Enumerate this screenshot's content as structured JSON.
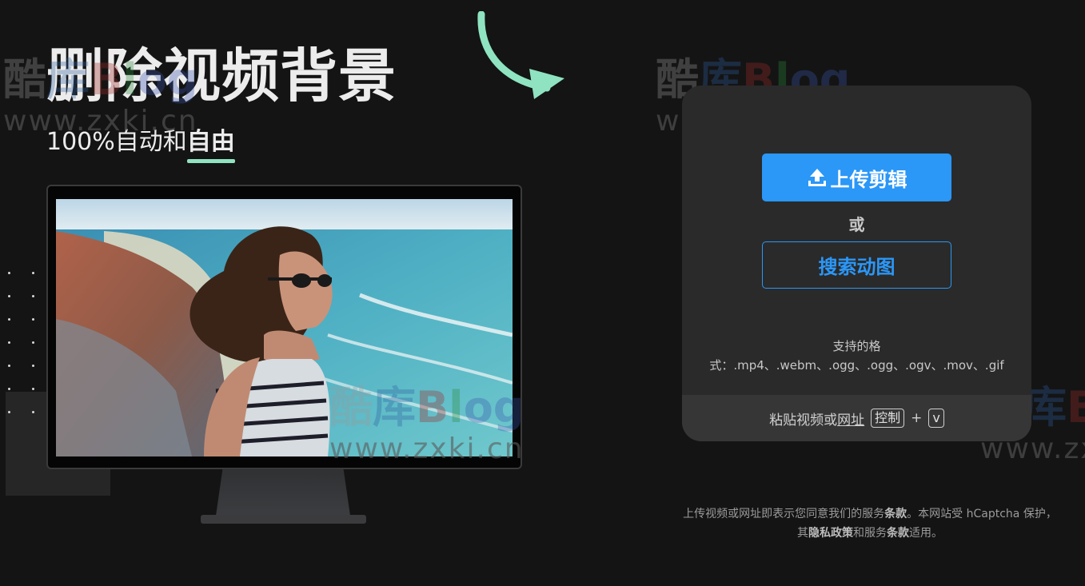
{
  "hero": {
    "title": "删除视频背景",
    "subtitle_prefix": "100%自动和",
    "subtitle_emphasis": "自由"
  },
  "upload": {
    "upload_button_label": "上传剪辑",
    "or_text": "或",
    "search_button_label": "搜索动图",
    "formats_line1": "支持的格",
    "formats_line2": "式：.mp4、.webm、.ogg、.ogg、.ogv、.mov、.gif",
    "paste_text": "粘贴视频或",
    "paste_link_text": "网址",
    "key_ctrl": "控制",
    "key_plus": "+",
    "key_v": "v"
  },
  "legal": {
    "part1": "上传视频或网址即表示您同意我们的服务",
    "terms1": "条款",
    "part2": "。本网站受 hCaptcha 保护，其",
    "privacy": "隐私政策",
    "part3": "和服务",
    "terms2": "条款",
    "part4": "适用。"
  },
  "watermark": {
    "char1": "酷",
    "char2": "库",
    "b": "B",
    "l": "l",
    "og": "og",
    "url": "www.zxki.cn"
  },
  "colors": {
    "accent_blue": "#2b97f7",
    "accent_mint": "#8fe3c0",
    "background": "#141414",
    "card": "#2a2a2a"
  },
  "icons": {
    "upload": "upload-icon",
    "arrow": "curved-arrow-icon"
  }
}
